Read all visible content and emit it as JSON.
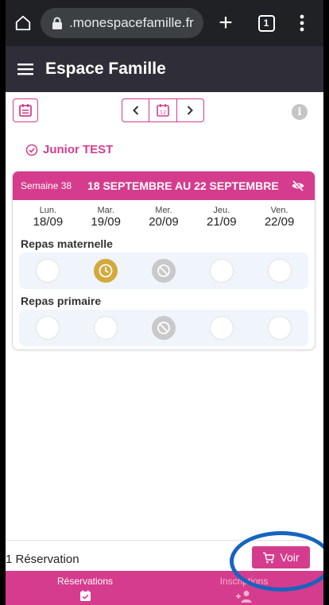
{
  "browser": {
    "url": ".monespacefamille.fr",
    "tab_count": "1",
    "new_tab_symbol": "+"
  },
  "app": {
    "title": "Espace Famille"
  },
  "toolbar": {
    "calendar_day": "12",
    "info_symbol": "i"
  },
  "child": {
    "name": "Junior TEST"
  },
  "week": {
    "label": "Semaine 38",
    "range": "18 SEPTEMBRE AU 22 SEPTEMBRE",
    "days": [
      {
        "name": "Lun.",
        "date": "18/09"
      },
      {
        "name": "Mar.",
        "date": "19/09"
      },
      {
        "name": "Mer.",
        "date": "20/09"
      },
      {
        "name": "Jeu.",
        "date": "21/09"
      },
      {
        "name": "Ven.",
        "date": "22/09"
      }
    ]
  },
  "sections": [
    {
      "title": "Repas maternelle",
      "slots": [
        "empty",
        "pending",
        "closed",
        "empty",
        "empty"
      ]
    },
    {
      "title": "Repas primaire",
      "slots": [
        "empty",
        "empty",
        "closed",
        "empty",
        "empty"
      ]
    }
  ],
  "footer": {
    "reservation_count": "1 Réservation",
    "voir_label": "Voir"
  },
  "bottom_nav": [
    {
      "label": "Réservations",
      "icon": "calendar-check-icon",
      "active": true
    },
    {
      "label": "Inscriptions",
      "icon": "person-add-icon",
      "active": false
    }
  ],
  "colors": {
    "brand": "#d63c8d",
    "app_bar": "#2f2e38",
    "pending": "#d4a93c",
    "closed": "#c9c9c9",
    "annotation": "#1565c0"
  }
}
